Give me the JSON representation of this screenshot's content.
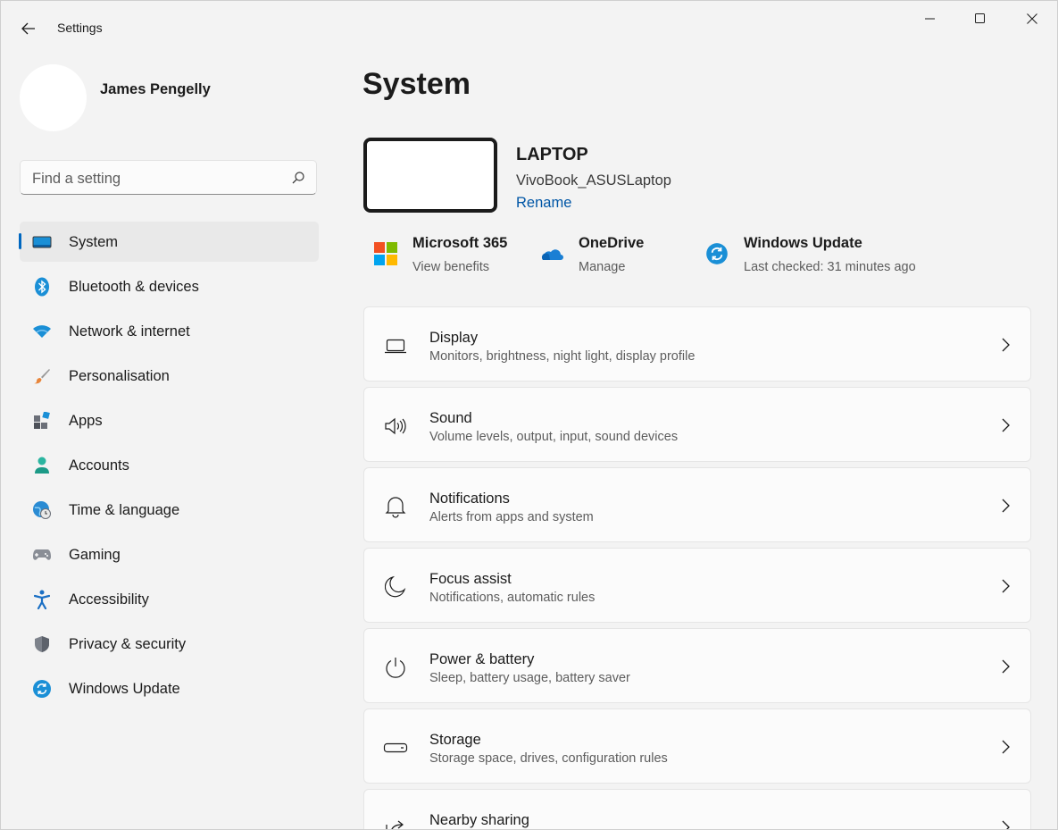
{
  "window": {
    "title": "Settings",
    "controls": [
      "minimize-icon",
      "maximize-icon",
      "close-icon"
    ]
  },
  "user": {
    "name": "James Pengelly"
  },
  "search": {
    "placeholder": "Find a setting"
  },
  "sidebar": {
    "items": [
      {
        "label": "System",
        "icon": "system-icon",
        "active": true
      },
      {
        "label": "Bluetooth & devices",
        "icon": "bluetooth-icon"
      },
      {
        "label": "Network & internet",
        "icon": "wifi-icon"
      },
      {
        "label": "Personalisation",
        "icon": "brush-icon"
      },
      {
        "label": "Apps",
        "icon": "apps-icon"
      },
      {
        "label": "Accounts",
        "icon": "account-icon"
      },
      {
        "label": "Time & language",
        "icon": "globe-clock-icon"
      },
      {
        "label": "Gaming",
        "icon": "gamepad-icon"
      },
      {
        "label": "Accessibility",
        "icon": "accessibility-icon"
      },
      {
        "label": "Privacy & security",
        "icon": "shield-icon"
      },
      {
        "label": "Windows Update",
        "icon": "update-icon"
      }
    ]
  },
  "main": {
    "title": "System",
    "device": {
      "name": "LAPTOP",
      "model": "VivoBook_ASUSLaptop",
      "rename_label": "Rename"
    },
    "quick_links": [
      {
        "title": "Microsoft 365",
        "subtitle": "View benefits",
        "icon": "microsoft-logo-icon"
      },
      {
        "title": "OneDrive",
        "subtitle": "Manage",
        "icon": "onedrive-icon"
      },
      {
        "title": "Windows Update",
        "subtitle": "Last checked: 31 minutes ago",
        "icon": "update-icon"
      }
    ],
    "cards": [
      {
        "title": "Display",
        "subtitle": "Monitors, brightness, night light, display profile",
        "icon": "display-icon"
      },
      {
        "title": "Sound",
        "subtitle": "Volume levels, output, input, sound devices",
        "icon": "speaker-icon"
      },
      {
        "title": "Notifications",
        "subtitle": "Alerts from apps and system",
        "icon": "bell-icon"
      },
      {
        "title": "Focus assist",
        "subtitle": "Notifications, automatic rules",
        "icon": "moon-icon"
      },
      {
        "title": "Power & battery",
        "subtitle": "Sleep, battery usage, battery saver",
        "icon": "power-icon"
      },
      {
        "title": "Storage",
        "subtitle": "Storage space, drives, configuration rules",
        "icon": "storage-icon"
      },
      {
        "title": "Nearby sharing",
        "subtitle": "",
        "icon": "share-icon"
      }
    ]
  },
  "colors": {
    "accent": "#0067c0",
    "link": "#0056a6",
    "background": "#f3f3f3",
    "card": "#fbfbfb"
  }
}
